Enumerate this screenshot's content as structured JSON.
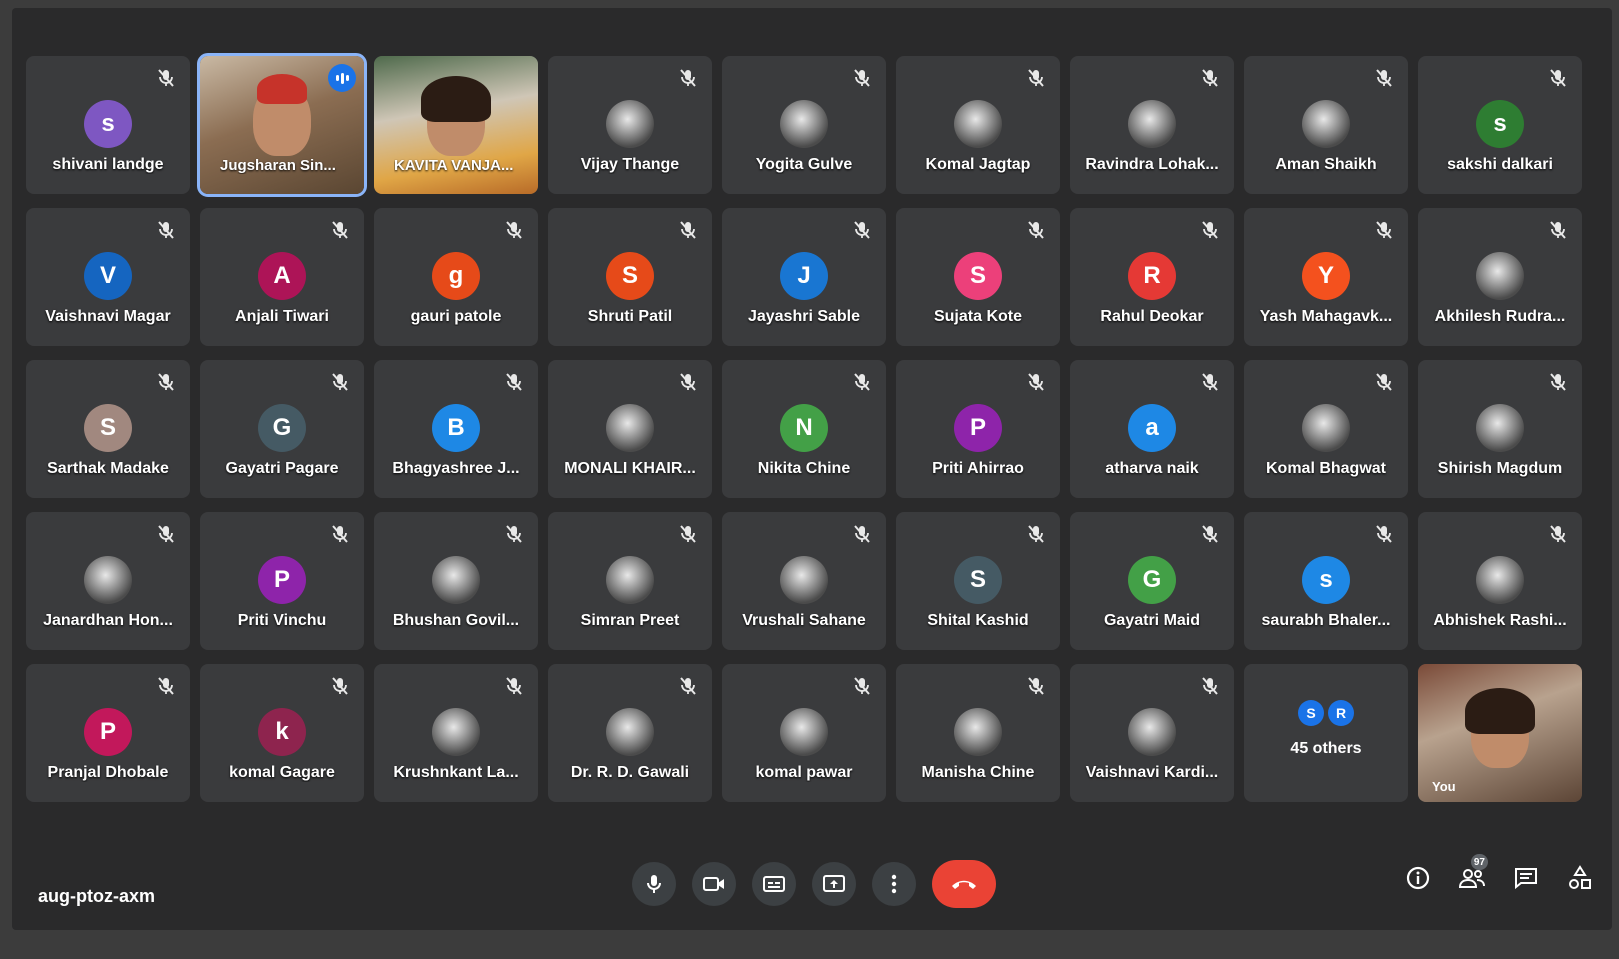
{
  "meeting": {
    "code": "aug-ptoz-axm"
  },
  "video_tiles": [
    {
      "name": "Jugsharan Sin..."
    },
    {
      "name": "KAVITA VANJA..."
    }
  ],
  "participants": [
    {
      "name": "shivani landge",
      "initial": "s",
      "color": "#7e57c2"
    },
    {
      "name": "Vijay Thange",
      "photo": true
    },
    {
      "name": "Yogita Gulve",
      "photo": true
    },
    {
      "name": "Komal Jagtap",
      "photo": true
    },
    {
      "name": "Ravindra Lohak...",
      "photo": true
    },
    {
      "name": "Aman Shaikh",
      "photo": true
    },
    {
      "name": "sakshi dalkari",
      "initial": "s",
      "color": "#2e7d32"
    },
    {
      "name": "Vaishnavi Magar",
      "initial": "V",
      "color": "#1565c0"
    },
    {
      "name": "Anjali Tiwari",
      "initial": "A",
      "color": "#ad1457"
    },
    {
      "name": "gauri patole",
      "initial": "g",
      "color": "#e64a19"
    },
    {
      "name": "Shruti Patil",
      "initial": "S",
      "color": "#e64a19"
    },
    {
      "name": "Jayashri Sable",
      "initial": "J",
      "color": "#1976d2"
    },
    {
      "name": "Sujata Kote",
      "initial": "S",
      "color": "#ec407a"
    },
    {
      "name": "Rahul Deokar",
      "initial": "R",
      "color": "#e53935"
    },
    {
      "name": "Yash Mahagavk...",
      "initial": "Y",
      "color": "#f4511e"
    },
    {
      "name": "Akhilesh Rudra...",
      "photo": true
    },
    {
      "name": "Sarthak Madake",
      "initial": "S",
      "color": "#a1887f"
    },
    {
      "name": "Gayatri Pagare",
      "initial": "G",
      "color": "#455a64"
    },
    {
      "name": "Bhagyashree J...",
      "initial": "B",
      "color": "#1e88e5"
    },
    {
      "name": "MONALI KHAIR...",
      "photo": true
    },
    {
      "name": "Nikita Chine",
      "initial": "N",
      "color": "#43a047"
    },
    {
      "name": "Priti Ahirrao",
      "initial": "P",
      "color": "#8e24aa"
    },
    {
      "name": "atharva naik",
      "initial": "a",
      "color": "#1e88e5"
    },
    {
      "name": "Komal Bhagwat",
      "photo": true
    },
    {
      "name": "Shirish Magdum",
      "photo": true
    },
    {
      "name": "Janardhan Hon...",
      "photo": true
    },
    {
      "name": "Priti Vinchu",
      "initial": "P",
      "color": "#8e24aa"
    },
    {
      "name": "Bhushan Govil...",
      "photo": true
    },
    {
      "name": "Simran Preet",
      "photo": true
    },
    {
      "name": "Vrushali Sahane",
      "photo": true
    },
    {
      "name": "Shital Kashid",
      "initial": "S",
      "color": "#455a64"
    },
    {
      "name": "Gayatri Maid",
      "initial": "G",
      "color": "#43a047"
    },
    {
      "name": "saurabh Bhaler...",
      "initial": "s",
      "color": "#1e88e5"
    },
    {
      "name": "Abhishek Rashi...",
      "photo": true
    },
    {
      "name": "Pranjal Dhobale",
      "initial": "P",
      "color": "#c2185b"
    },
    {
      "name": "komal Gagare",
      "initial": "k",
      "color": "#8e244e"
    },
    {
      "name": "Krushnkant La...",
      "photo": true
    },
    {
      "name": "Dr. R. D. Gawali",
      "photo": true
    },
    {
      "name": "komal pawar",
      "photo": true
    },
    {
      "name": "Manisha Chine",
      "photo": true
    },
    {
      "name": "Vaishnavi Kardi...",
      "photo": true
    }
  ],
  "others": {
    "label": "45 others",
    "chips": [
      "S",
      "R"
    ]
  },
  "self": {
    "label": "You"
  },
  "participant_count": "97",
  "icons": {
    "mic": "mic-icon",
    "camera": "camera-icon",
    "captions": "captions-icon",
    "present": "present-icon",
    "more": "more-vert-icon",
    "end_call": "call-end-icon",
    "info": "info-icon",
    "people": "people-icon",
    "chat": "chat-icon",
    "activities": "activities-icon"
  }
}
